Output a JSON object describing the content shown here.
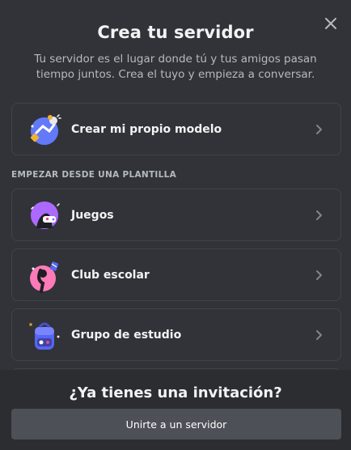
{
  "dialog": {
    "title": "Crea tu servidor",
    "subtitle": "Tu servidor es el lugar donde tú y tus amigos pasan tiempo juntos. Crea el tuyo y empieza a conversar.",
    "close_icon": "close-icon"
  },
  "create_own": {
    "label": "Crear mi propio modelo",
    "icon": "custom-server-illustration"
  },
  "templates": {
    "heading": "EMPEZAR DESDE UNA PLANTILLA",
    "items": [
      {
        "label": "Juegos",
        "icon": "gaming-illustration"
      },
      {
        "label": "Club escolar",
        "icon": "school-club-illustration"
      },
      {
        "label": "Grupo de estudio",
        "icon": "study-group-illustration"
      }
    ]
  },
  "footer": {
    "title": "¿Ya tienes una invitación?",
    "join_label": "Unirte a un servidor"
  },
  "colors": {
    "background": "#313338",
    "footer_background": "#2b2d31",
    "button_background": "#4e5058",
    "card_border": "#41434a",
    "text_muted": "#b5bac1"
  }
}
